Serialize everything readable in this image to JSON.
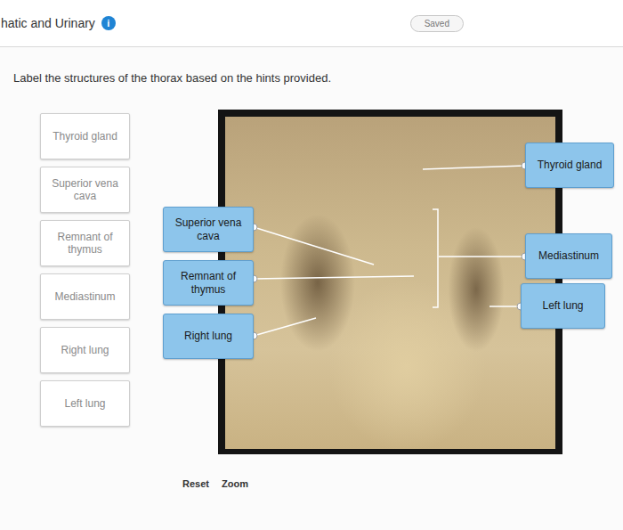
{
  "header": {
    "title": "hatic and Urinary",
    "info": "i",
    "status": "Saved"
  },
  "instruction": "Label the structures of the thorax based on the hints provided.",
  "word_bank": [
    {
      "label": "Thyroid gland",
      "used": true
    },
    {
      "label": "Superior vena cava",
      "used": true
    },
    {
      "label": "Remnant of thymus",
      "used": true
    },
    {
      "label": "Mediastinum",
      "used": true
    },
    {
      "label": "Right lung",
      "used": true
    },
    {
      "label": "Left lung",
      "used": true
    }
  ],
  "placed_labels": [
    {
      "label": "Superior vena cava"
    },
    {
      "label": "Remnant of thymus"
    },
    {
      "label": "Right lung"
    },
    {
      "label": "Thyroid gland"
    },
    {
      "label": "Mediastinum"
    },
    {
      "label": "Left lung"
    }
  ],
  "buttons": [
    "Reset",
    "Zoom"
  ]
}
